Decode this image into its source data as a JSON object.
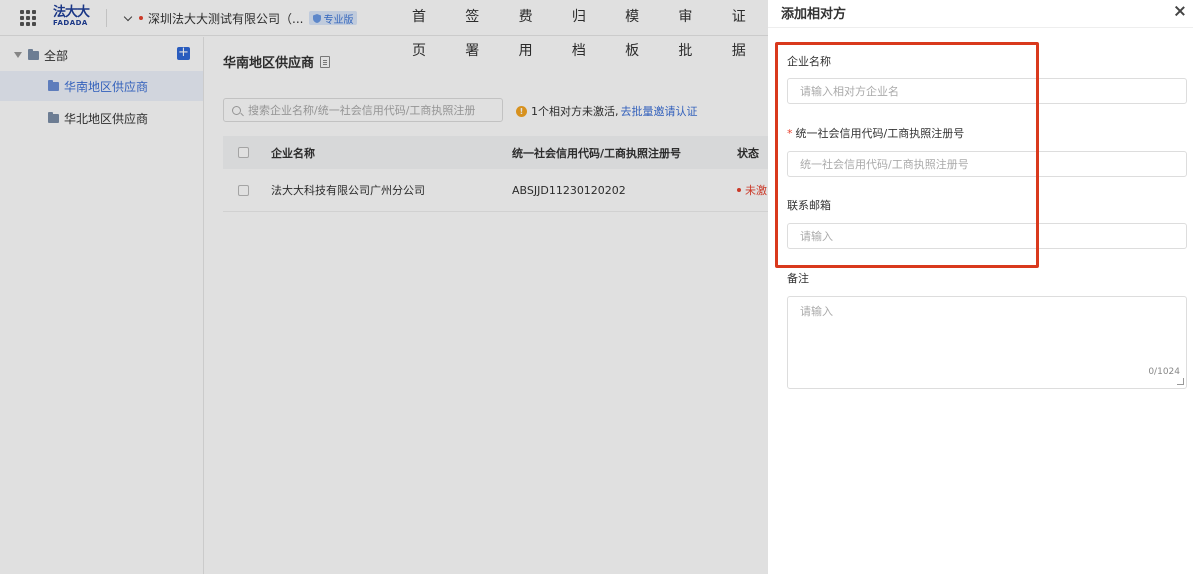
{
  "header": {
    "logo_cn": "法大大",
    "logo_en": "FADADA",
    "company": "深圳法大大测试有限公司（...",
    "edition_badge": "专业版",
    "nav": [
      "首页",
      "签署",
      "费用",
      "归档",
      "模板",
      "审批",
      "证据"
    ]
  },
  "sidebar": {
    "root_label": "全部",
    "items": [
      {
        "label": "华南地区供应商",
        "active": true
      },
      {
        "label": "华北地区供应商",
        "active": false
      }
    ]
  },
  "main": {
    "title": "华南地区供应商",
    "search_placeholder": "搜索企业名称/统一社会信用代码/工商执照注册",
    "notice_text": "1个相对方未激活,",
    "notice_link": "去批量邀请认证",
    "table": {
      "columns": [
        "企业名称",
        "统一社会信用代码/工商执照注册号",
        "状态"
      ],
      "rows": [
        {
          "name": "法大大科技有限公司广州分公司",
          "code": "ABSJJD11230120202",
          "status": "未激"
        }
      ]
    }
  },
  "drawer": {
    "title": "添加相对方",
    "fields": {
      "company_name": {
        "label": "企业名称",
        "placeholder": "请输入相对方企业名"
      },
      "credit_code": {
        "label": "统一社会信用代码/工商执照注册号",
        "placeholder": "统一社会信用代码/工商执照注册号",
        "required_mark": "*"
      },
      "email": {
        "label": "联系邮箱",
        "placeholder": "请输入"
      },
      "remark": {
        "label": "备注",
        "placeholder": "请输入",
        "counter": "0/1024"
      }
    }
  },
  "colors": {
    "brand": "#1f3f99",
    "accent": "#3b6fd6",
    "error": "#e8422f",
    "warning": "#f5a623",
    "highlight_box": "#d9391d"
  }
}
